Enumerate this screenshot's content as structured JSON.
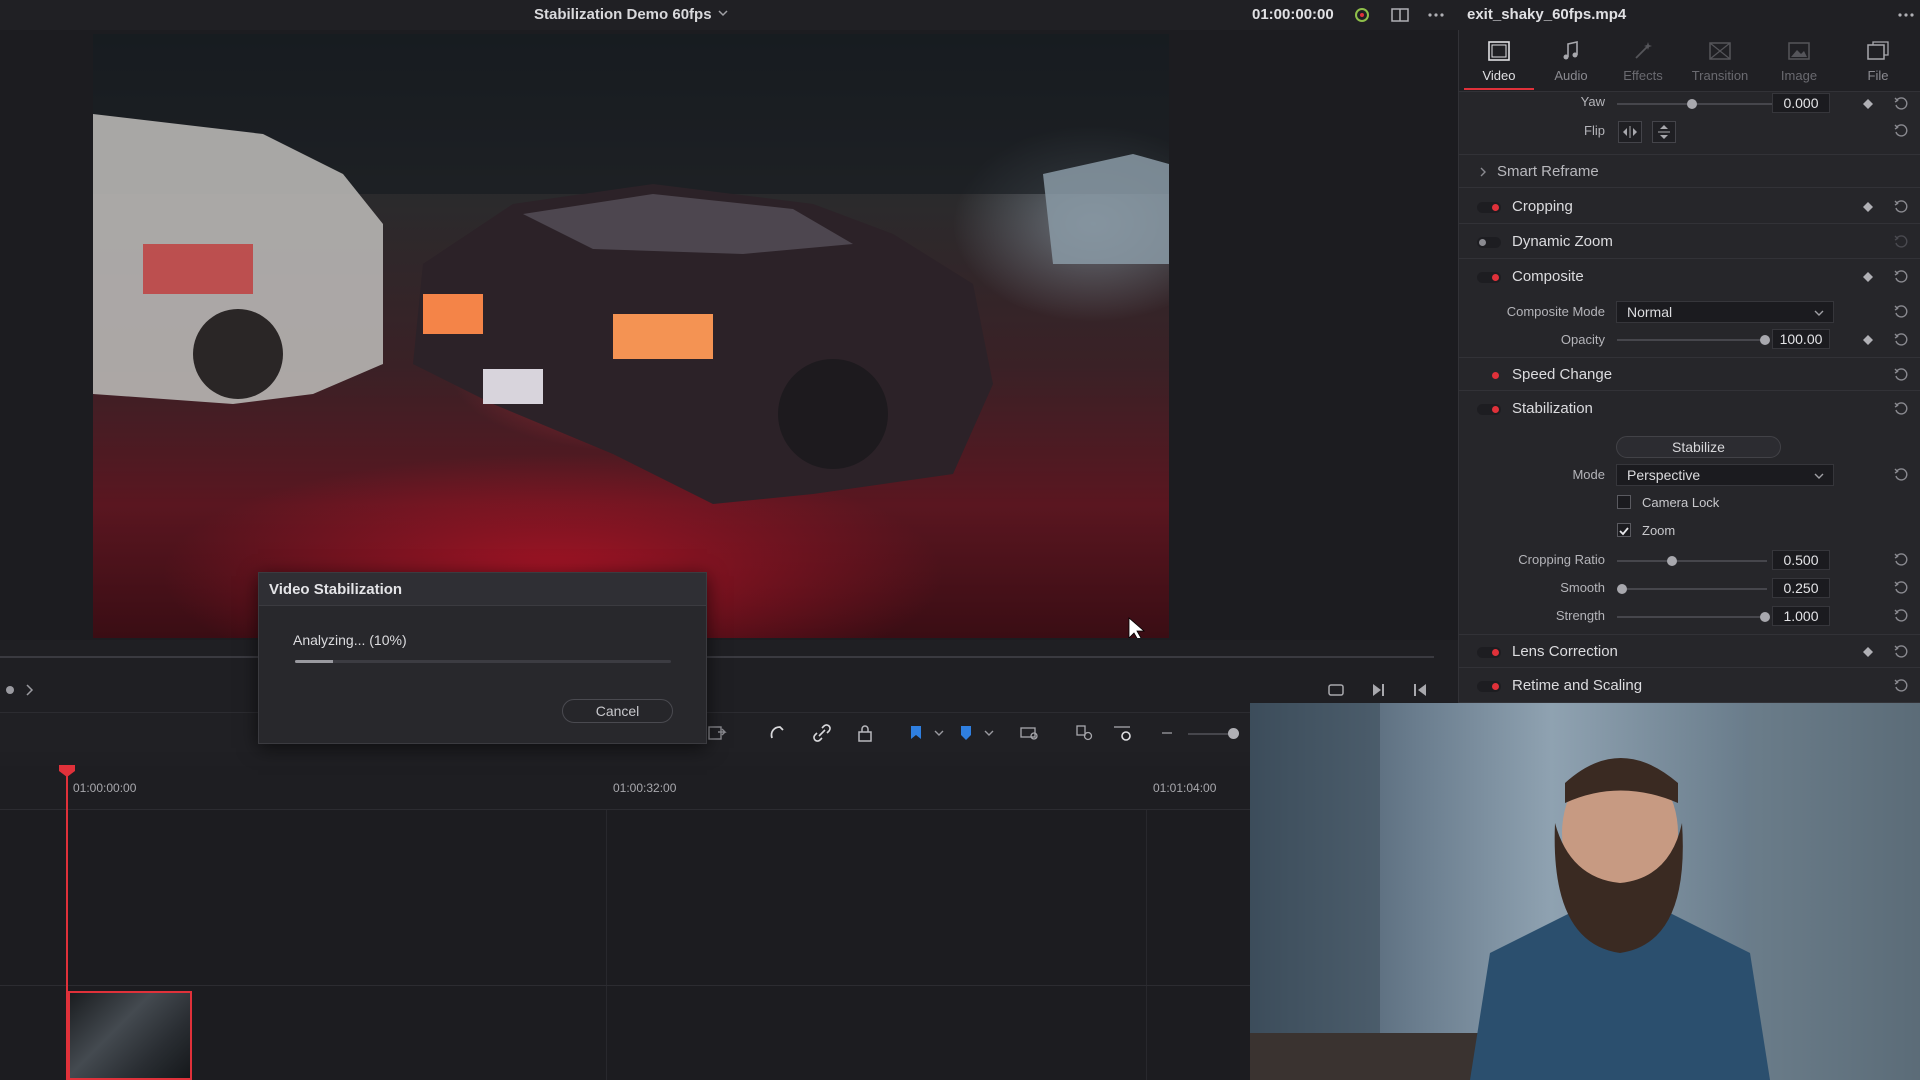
{
  "header": {
    "project_title": "Stabilization Demo 60fps",
    "timecode": "01:00:00:00",
    "clip_name": "exit_shaky_60fps.mp4"
  },
  "dialog": {
    "title": "Video Stabilization",
    "status": "Analyzing... (10%)",
    "progress": 0.1,
    "cancel_label": "Cancel"
  },
  "timeline": {
    "ruler_labels": [
      "01:00:00:00",
      "01:00:32:00",
      "01:01:04:00"
    ]
  },
  "inspector": {
    "tabs": [
      {
        "label": "Video",
        "icon": "film-icon",
        "active": true
      },
      {
        "label": "Audio",
        "icon": "music-note-icon",
        "active": false
      },
      {
        "label": "Effects",
        "icon": "magic-wand-icon",
        "active": false
      },
      {
        "label": "Transition",
        "icon": "transition-icon",
        "active": false
      },
      {
        "label": "Image",
        "icon": "image-icon",
        "active": false
      },
      {
        "label": "File",
        "icon": "file-icon",
        "active": false
      }
    ],
    "transform": {
      "yaw_label": "Yaw",
      "yaw_value": "0.000",
      "flip_label": "Flip"
    },
    "sections": {
      "smart_reframe": "Smart Reframe",
      "cropping": "Cropping",
      "dynamic_zoom": "Dynamic Zoom",
      "composite": "Composite",
      "speed_change": "Speed Change",
      "stabilization": "Stabilization",
      "lens_correction": "Lens Correction",
      "retime_scaling": "Retime and Scaling"
    },
    "composite": {
      "mode_label": "Composite Mode",
      "mode_value": "Normal",
      "opacity_label": "Opacity",
      "opacity_value": "100.00"
    },
    "stabilization": {
      "button_label": "Stabilize",
      "mode_label": "Mode",
      "mode_value": "Perspective",
      "camera_lock_label": "Camera Lock",
      "camera_lock_checked": false,
      "zoom_label": "Zoom",
      "zoom_checked": true,
      "cropping_ratio_label": "Cropping Ratio",
      "cropping_ratio_value": "0.500",
      "smooth_label": "Smooth",
      "smooth_value": "0.250",
      "strength_label": "Strength",
      "strength_value": "1.000"
    }
  },
  "colors": {
    "accent_red": "#e0313a",
    "panel_bg": "#26262a",
    "dark_bg": "#1c1c20"
  }
}
